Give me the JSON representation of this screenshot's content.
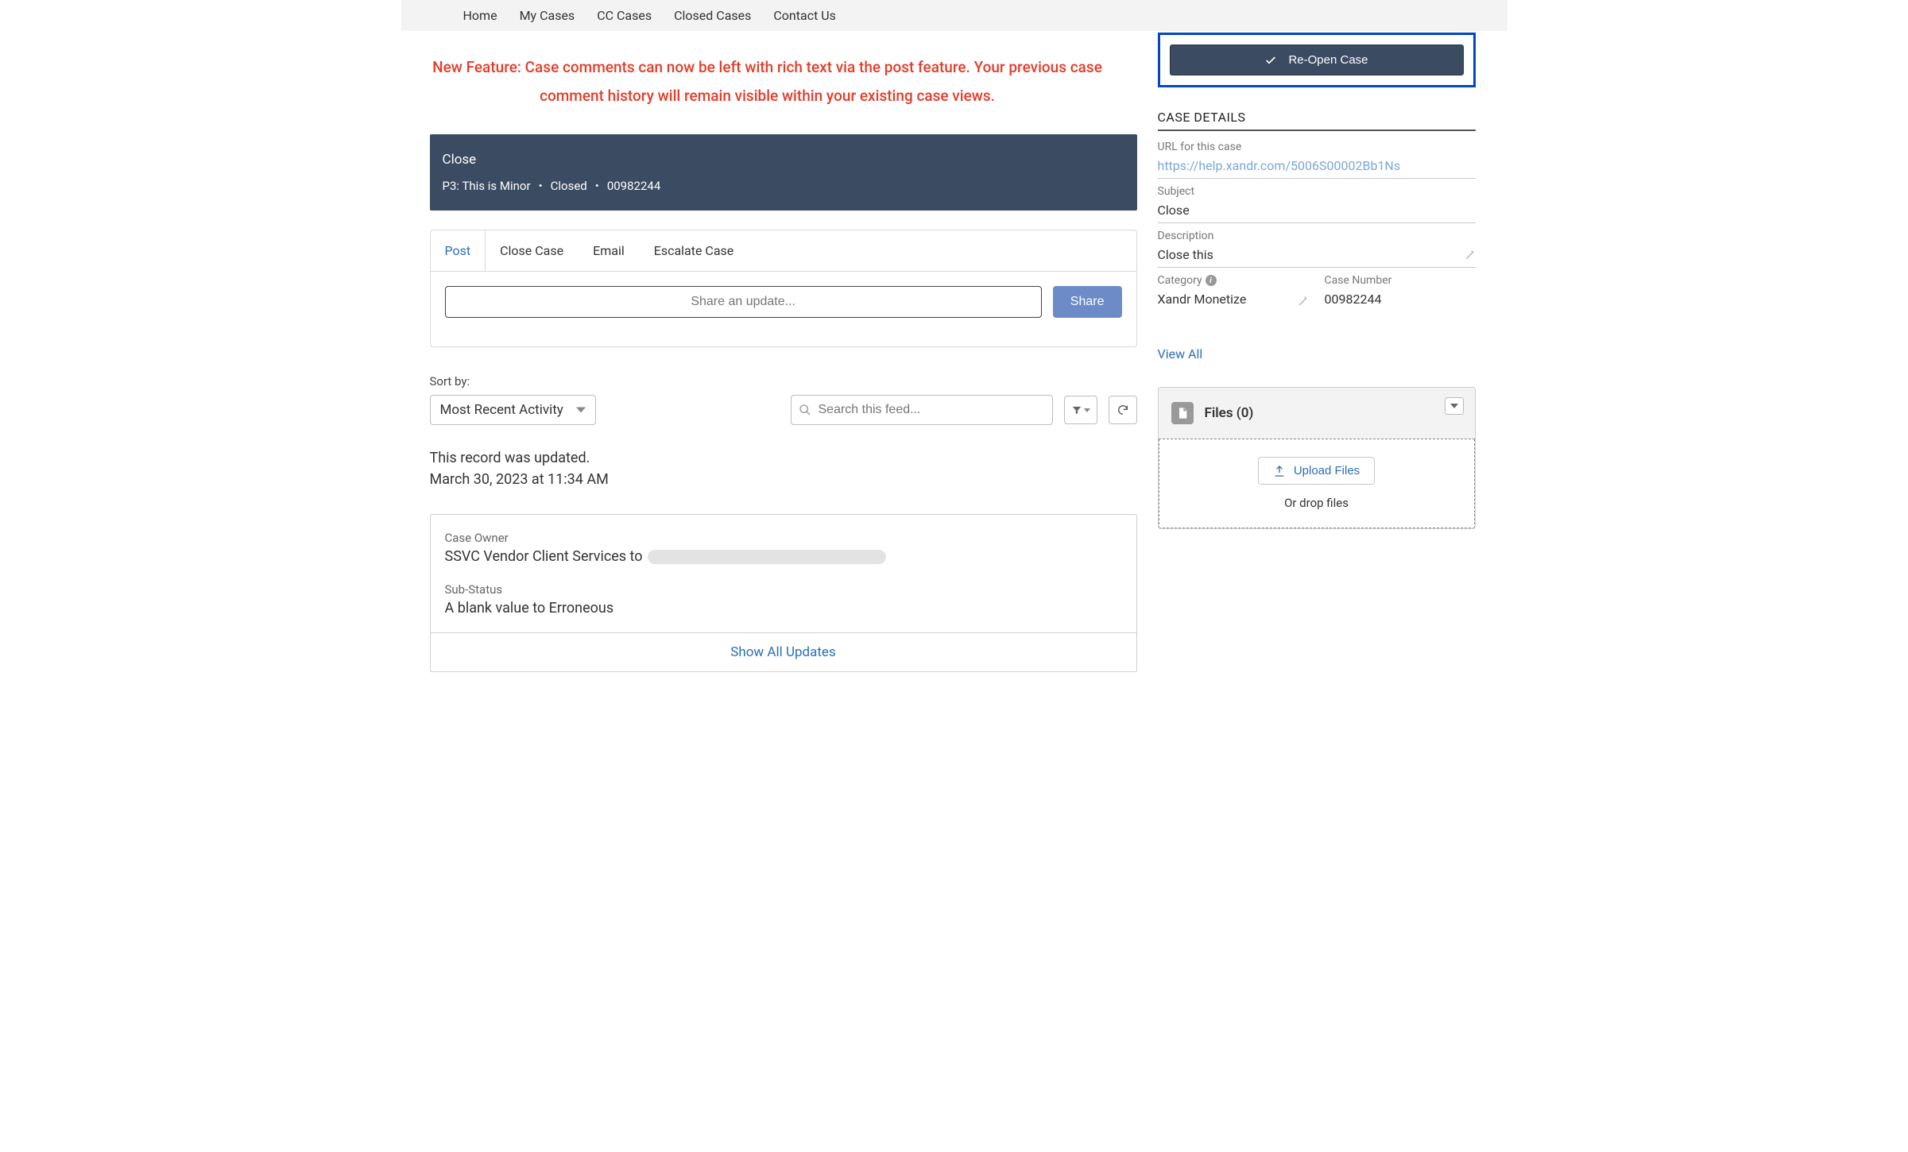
{
  "nav": {
    "items": [
      "Home",
      "My Cases",
      "CC Cases",
      "Closed Cases",
      "Contact Us"
    ]
  },
  "banner": {
    "text": "New Feature: Case comments can now be left with rich text via the post feature. Your previous case comment history will remain visible within your existing case views."
  },
  "case_header": {
    "title": "Close",
    "priority": "P3: This is Minor",
    "status": "Closed",
    "number": "00982244"
  },
  "tabs": [
    "Post",
    "Close Case",
    "Email",
    "Escalate Case"
  ],
  "compose": {
    "placeholder": "Share an update...",
    "share_label": "Share"
  },
  "feed": {
    "sort_label": "Sort by:",
    "sort_value": "Most Recent Activity",
    "search_placeholder": "Search this feed...",
    "update_line1": "This record was updated.",
    "update_line2": "March 30, 2023 at 11:34 AM",
    "case_owner_label": "Case Owner",
    "case_owner_value": "SSVC Vendor Client Services to",
    "sub_status_label": "Sub-Status",
    "sub_status_value": "A blank value to Erroneous",
    "show_all": "Show All Updates"
  },
  "sidebar": {
    "reopen_label": "Re-Open Case",
    "details_heading": "CASE DETAILS",
    "url_label": "URL for this case",
    "url_value": "https://help.xandr.com/5006S00002Bb1Ns",
    "subject_label": "Subject",
    "subject_value": "Close",
    "description_label": "Description",
    "description_value": "Close this",
    "category_label": "Category",
    "category_value": "Xandr Monetize",
    "case_number_label": "Case Number",
    "case_number_value": "00982244",
    "view_all": "View All"
  },
  "files": {
    "title": "Files (0)",
    "upload_label": "Upload Files",
    "drop_text": "Or drop files"
  }
}
